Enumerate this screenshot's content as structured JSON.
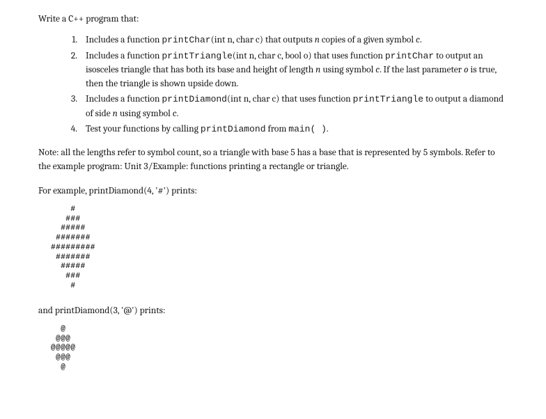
{
  "intro": "Write a C++ program that:",
  "items": [
    {
      "num": "1.",
      "parts": [
        {
          "t": "text",
          "v": "Includes a function "
        },
        {
          "t": "code",
          "v": "printChar"
        },
        {
          "t": "text",
          "v": "(int n, char c) that outputs "
        },
        {
          "t": "em",
          "v": "n"
        },
        {
          "t": "text",
          "v": " copies of a given symbol "
        },
        {
          "t": "em",
          "v": "c"
        },
        {
          "t": "text",
          "v": "."
        }
      ]
    },
    {
      "num": "2.",
      "parts": [
        {
          "t": "text",
          "v": "Includes a function "
        },
        {
          "t": "code",
          "v": "printTriangle"
        },
        {
          "t": "text",
          "v": "(int n, char c, bool o) that uses function "
        },
        {
          "t": "code",
          "v": "printChar"
        },
        {
          "t": "text",
          "v": " to output an isosceles triangle that has both its base and height of length "
        },
        {
          "t": "em",
          "v": "n"
        },
        {
          "t": "text",
          "v": " using symbol "
        },
        {
          "t": "em",
          "v": "c"
        },
        {
          "t": "text",
          "v": ". If the last parameter "
        },
        {
          "t": "em",
          "v": "o"
        },
        {
          "t": "text",
          "v": " is true, then the triangle is shown upside down."
        }
      ]
    },
    {
      "num": "3.",
      "parts": [
        {
          "t": "text",
          "v": "Includes a function "
        },
        {
          "t": "code",
          "v": "printDiamond"
        },
        {
          "t": "text",
          "v": "(int n, char c) that uses function "
        },
        {
          "t": "code",
          "v": "printTriangle"
        },
        {
          "t": "text",
          "v": " to output a diamond of side "
        },
        {
          "t": "em",
          "v": "n"
        },
        {
          "t": "text",
          "v": " using symbol "
        },
        {
          "t": "em",
          "v": "c"
        },
        {
          "t": "text",
          "v": "."
        }
      ]
    },
    {
      "num": "4.",
      "parts": [
        {
          "t": "text",
          "v": "Test your functions by calling "
        },
        {
          "t": "code",
          "v": "printDiamond"
        },
        {
          "t": "text",
          "v": " from "
        },
        {
          "t": "code",
          "v": "main( )"
        },
        {
          "t": "text",
          "v": "."
        }
      ]
    }
  ],
  "note": "Note: all the lengths refer to symbol count, so a triangle with base 5 has a base that is represented by 5 symbols. Refer to the example program: Unit 3/Example: functions printing a rectangle or triangle.",
  "example1_label": "For example, printDiamond(4, '#') prints:",
  "diamond1": "    #\n   ###\n  #####\n #######\n#########\n #######\n  #####\n   ###\n    #",
  "example2_label": "and printDiamond(3, '@') prints:",
  "diamond2": "  @\n @@@\n@@@@@\n @@@\n  @"
}
